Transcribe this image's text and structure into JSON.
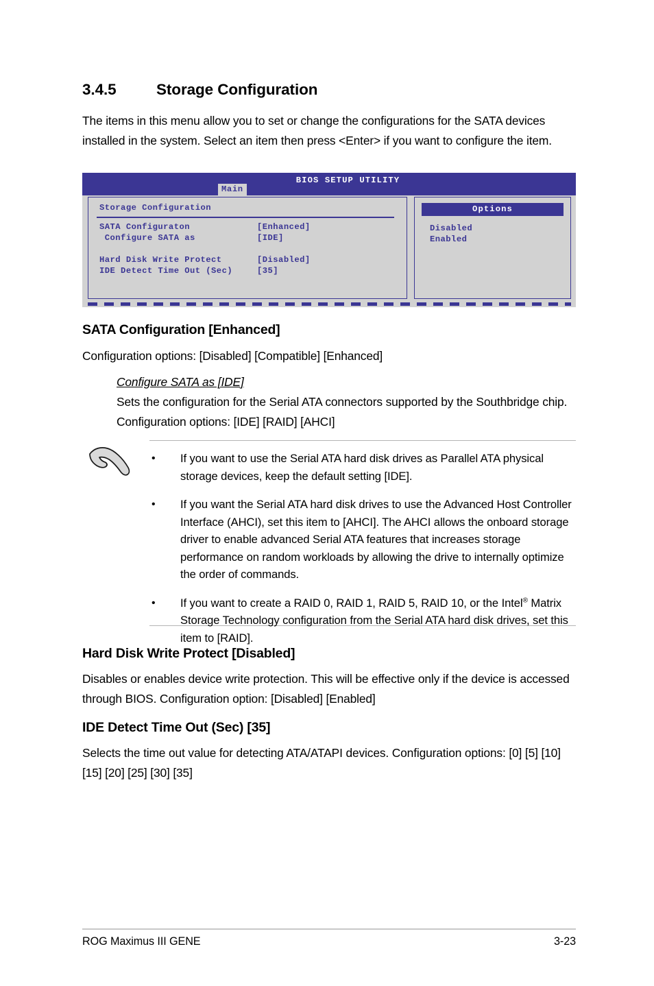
{
  "section": {
    "number": "3.4.5",
    "title": "Storage Configuration",
    "intro": "The items in this menu allow you to set or change the configurations for the SATA devices installed in the system. Select an item then press <Enter> if you want to configure the item."
  },
  "bios": {
    "title": "BIOS SETUP UTILITY",
    "tab": "Main",
    "panel_heading": "Storage Configuration",
    "rows": [
      {
        "label": "SATA Configuraton",
        "value": "[Enhanced]"
      },
      {
        "label": " Configure SATA as",
        "value": "[IDE]"
      },
      {
        "label": "Hard Disk Write Protect",
        "value": "[Disabled]"
      },
      {
        "label": "IDE Detect Time Out (Sec)",
        "value": "[35]"
      }
    ],
    "options_title": "Options",
    "options": [
      "Disabled",
      "Enabled"
    ],
    "colors": {
      "accent": "#3b3694",
      "screen_bg": "#d2d2d2",
      "text": "#3b3694",
      "title_text": "#ffffff"
    }
  },
  "sata_config": {
    "heading": "SATA Configuration [Enhanced]",
    "body": "Configuration options: [Disabled] [Compatible] [Enhanced]",
    "sub_heading": "Configure SATA as [IDE]",
    "sub_body": "Sets the configuration for the Serial ATA connectors supported by the Southbridge chip. Configuration options: [IDE] [RAID] [AHCI]"
  },
  "note": {
    "icon": "note-hand-icon",
    "bullet": "•",
    "items": [
      "If you want to use the Serial ATA hard disk drives as Parallel ATA physical storage devices, keep the default setting [IDE].",
      "If you want the Serial ATA hard disk drives to use the Advanced Host Controller Interface (AHCI), set this item to [AHCI]. The AHCI allows the onboard storage driver to enable advanced Serial ATA features that increases storage performance on random workloads by allowing the drive to internally optimize the order of commands.",
      "If you want to create a RAID 0, RAID 1, RAID 5, RAID 10, or the Intel"
    ],
    "item3_rest": " Matrix Storage Technology configuration from the Serial ATA hard disk drives, set this item to [RAID]."
  },
  "hard_disk_write_protect": {
    "heading": "Hard Disk Write Protect [Disabled]",
    "body": "Disables or enables device write protection. This will be effective only if the device is accessed through BIOS. Configuration option: [Disabled] [Enabled]"
  },
  "ide_detect": {
    "heading": "IDE Detect Time Out (Sec) [35]",
    "body": "Selects the time out value for detecting ATA/ATAPI devices. Configuration options: [0] [5] [10] [15] [20] [25] [30] [35]"
  },
  "footer": {
    "left": "ROG Maximus III GENE",
    "right": "3-23"
  }
}
